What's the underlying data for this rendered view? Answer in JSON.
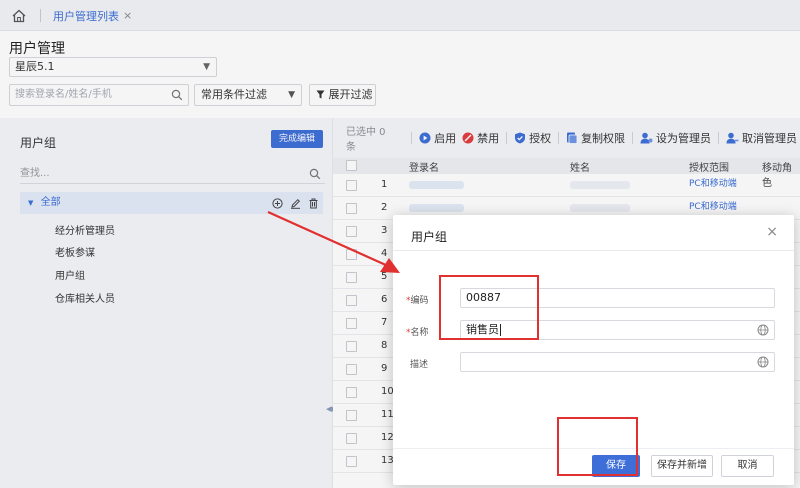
{
  "tabs": {
    "active_label": "用户管理列表",
    "close_symbol": "×"
  },
  "header": {
    "title": "用户管理",
    "org_select": "星辰5.1"
  },
  "filters": {
    "search_placeholder": "搜索登录名/姓名/手机",
    "condition_select": "常用条件过滤",
    "expand_label": "展开过滤"
  },
  "left_panel": {
    "title": "用户组",
    "done_button": "完成编辑",
    "search_placeholder": "查找...",
    "root_label": "全部",
    "groups": [
      "经分析管理员",
      "老板参谋",
      "用户组",
      "仓库相关人员"
    ]
  },
  "toolbar": {
    "selected_count": "已选中 0 条",
    "enable": "启用",
    "disable": "禁用",
    "authorize": "授权",
    "copy_perm": "复制权限",
    "set_admin": "设为管理员",
    "cancel_admin": "取消管理员"
  },
  "grid": {
    "columns": {
      "login": "登录名",
      "name": "姓名",
      "scope": "授权范围",
      "mobile_role": "移动角色"
    },
    "row_numbers": [
      "1",
      "2",
      "3",
      "4",
      "5",
      "6",
      "7",
      "8",
      "9",
      "10",
      "11",
      "12",
      "13"
    ],
    "scope_value": "PC和移动端"
  },
  "dialog": {
    "title": "用户组",
    "close_symbol": "×",
    "code_label": "编码",
    "code_value": "00887",
    "name_label": "名称",
    "name_value": "销售员",
    "desc_label": "描述",
    "desc_value": "",
    "required_mark": "*",
    "save": "保存",
    "save_new": "保存并新增",
    "cancel": "取消"
  },
  "colors": {
    "primary": "#3e6fd9",
    "annotation": "#e03030",
    "link": "#3b6fd6"
  }
}
